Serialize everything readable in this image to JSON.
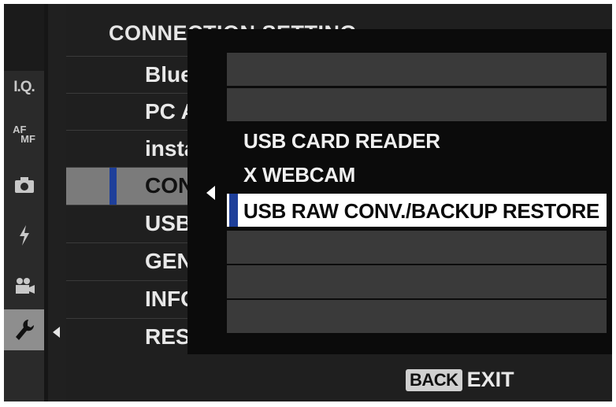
{
  "title": "CONNECTION SETTING",
  "left_icons": [
    {
      "label": "I.Q.",
      "icon": "image-quality-icon"
    },
    {
      "label_top": "AF",
      "label_bottom": "MF",
      "icon": "af-mf-icon"
    },
    {
      "icon": "camera-icon"
    },
    {
      "icon": "flash-icon"
    },
    {
      "icon": "movie-icon"
    },
    {
      "icon": "wrench-icon",
      "active": true
    }
  ],
  "menu_items": [
    {
      "label": "Blue"
    },
    {
      "label": "PC A"
    },
    {
      "label": "insta"
    },
    {
      "label": "CON",
      "selected": true
    },
    {
      "label": "USB"
    },
    {
      "label": "GEN"
    },
    {
      "label": "INFO"
    },
    {
      "label": "RES"
    }
  ],
  "submenu": {
    "options": [
      {
        "label": ""
      },
      {
        "label": ""
      },
      {
        "label": "USB CARD READER"
      },
      {
        "label": "X WEBCAM"
      },
      {
        "label": "USB RAW CONV./BACKUP RESTORE",
        "selected": true
      },
      {
        "label": ""
      },
      {
        "label": ""
      },
      {
        "label": ""
      }
    ]
  },
  "footer": {
    "back_label": "BACK",
    "exit_label": "EXIT"
  },
  "colors": {
    "accent": "#1e3f9a",
    "selected_row": "#7b7b7b",
    "popup_bg": "#0b0b0b"
  }
}
